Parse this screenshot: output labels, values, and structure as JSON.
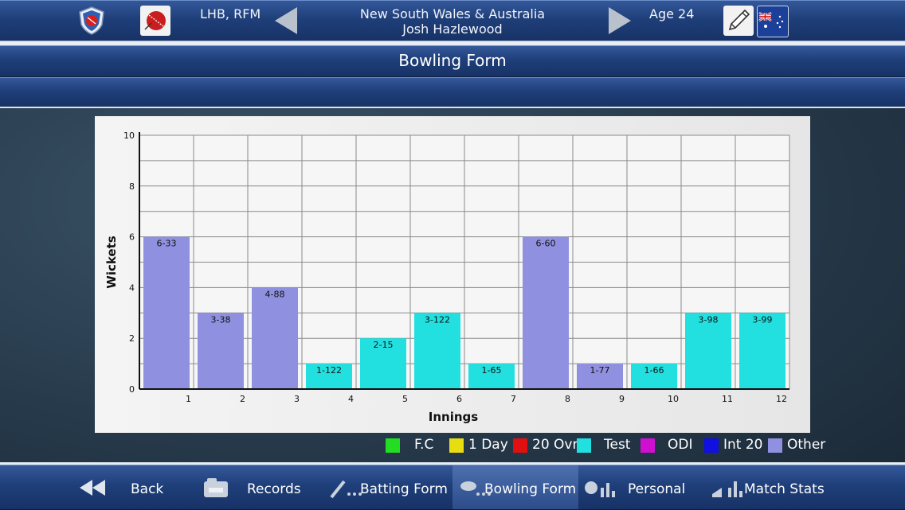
{
  "header": {
    "handedness": "LHB, RFM",
    "teams": "New South Wales & Australia",
    "player_name": "Josh Hazlewood",
    "age": "Age 24"
  },
  "page_title": "Bowling Form",
  "colors": {
    "fc": "#22dd22",
    "one_day": "#e8dd10",
    "t20": "#e01010",
    "test": "#22e0e0",
    "odi": "#d010d0",
    "int20": "#1010e0",
    "other": "#9090e0"
  },
  "chart_data": {
    "type": "bar",
    "xlabel": "Innings",
    "ylabel": "Wickets",
    "ylim": [
      0,
      10
    ],
    "yticks": [
      0,
      2,
      4,
      6,
      8,
      10
    ],
    "categories": [
      "1",
      "2",
      "3",
      "4",
      "5",
      "6",
      "7",
      "8",
      "9",
      "10",
      "11",
      "12"
    ],
    "values": [
      6,
      3,
      4,
      1,
      2,
      3,
      1,
      6,
      1,
      1,
      3,
      3
    ],
    "labels": [
      "6-33",
      "3-38",
      "4-88",
      "1-122",
      "2-15",
      "3-122",
      "1-65",
      "6-60",
      "1-77",
      "1-66",
      "3-98",
      "3-99"
    ],
    "formats": [
      "Other",
      "Other",
      "Other",
      "Test",
      "Test",
      "Test",
      "Test",
      "Other",
      "Other",
      "Test",
      "Test",
      "Test"
    ],
    "grid": true
  },
  "legend": [
    {
      "label": "F.C",
      "color": "#22dd22"
    },
    {
      "label": "1 Day",
      "color": "#e8dd10"
    },
    {
      "label": "20 Ovr",
      "color": "#e01010"
    },
    {
      "label": "Test",
      "color": "#22e0e0"
    },
    {
      "label": "ODI",
      "color": "#d010d0"
    },
    {
      "label": "Int 20",
      "color": "#1010e0"
    },
    {
      "label": "Other",
      "color": "#9090e0"
    }
  ],
  "nav": {
    "back": "Back",
    "records": "Records",
    "batting_form": "Batting Form",
    "bowling_form": "Bowling Form",
    "personal": "Personal",
    "match_stats": "Match Stats"
  }
}
